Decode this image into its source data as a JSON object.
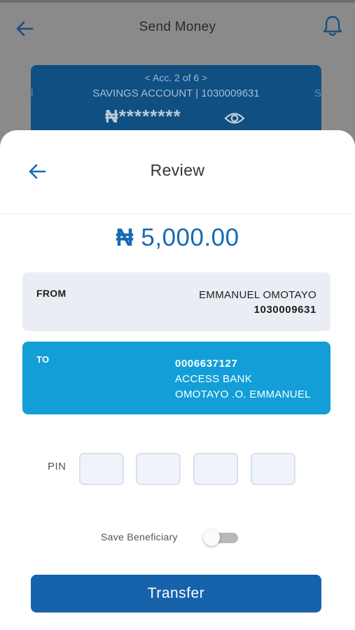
{
  "background": {
    "header_title": "Send Money",
    "card": {
      "nav_text": "< Acc. 2 of 6 >",
      "account_line": "SAVINGS ACCOUNT | 1030009631",
      "left_edge_text": "l",
      "right_edge_text": "S",
      "balance_currency": "₦",
      "balance_masked": "********"
    }
  },
  "review": {
    "title": "Review",
    "amount_currency": "₦",
    "amount_value": "5,000.00",
    "from": {
      "label": "FROM",
      "name": "EMMANUEL OMOTAYO",
      "account": "1030009631"
    },
    "to": {
      "label": "TO",
      "account": "0006637127",
      "bank": "ACCESS BANK",
      "name": "OMOTAYO .O. EMMANUEL"
    },
    "pin_label": "PIN",
    "save_beneficiary_label": "Save Beneficiary",
    "save_beneficiary_on": false,
    "transfer_label": "Transfer"
  },
  "colors": {
    "primary_blue": "#1663ac",
    "to_box_blue": "#139ed8",
    "amount_blue": "#1769b3",
    "from_box_gray": "#eaeef4"
  }
}
